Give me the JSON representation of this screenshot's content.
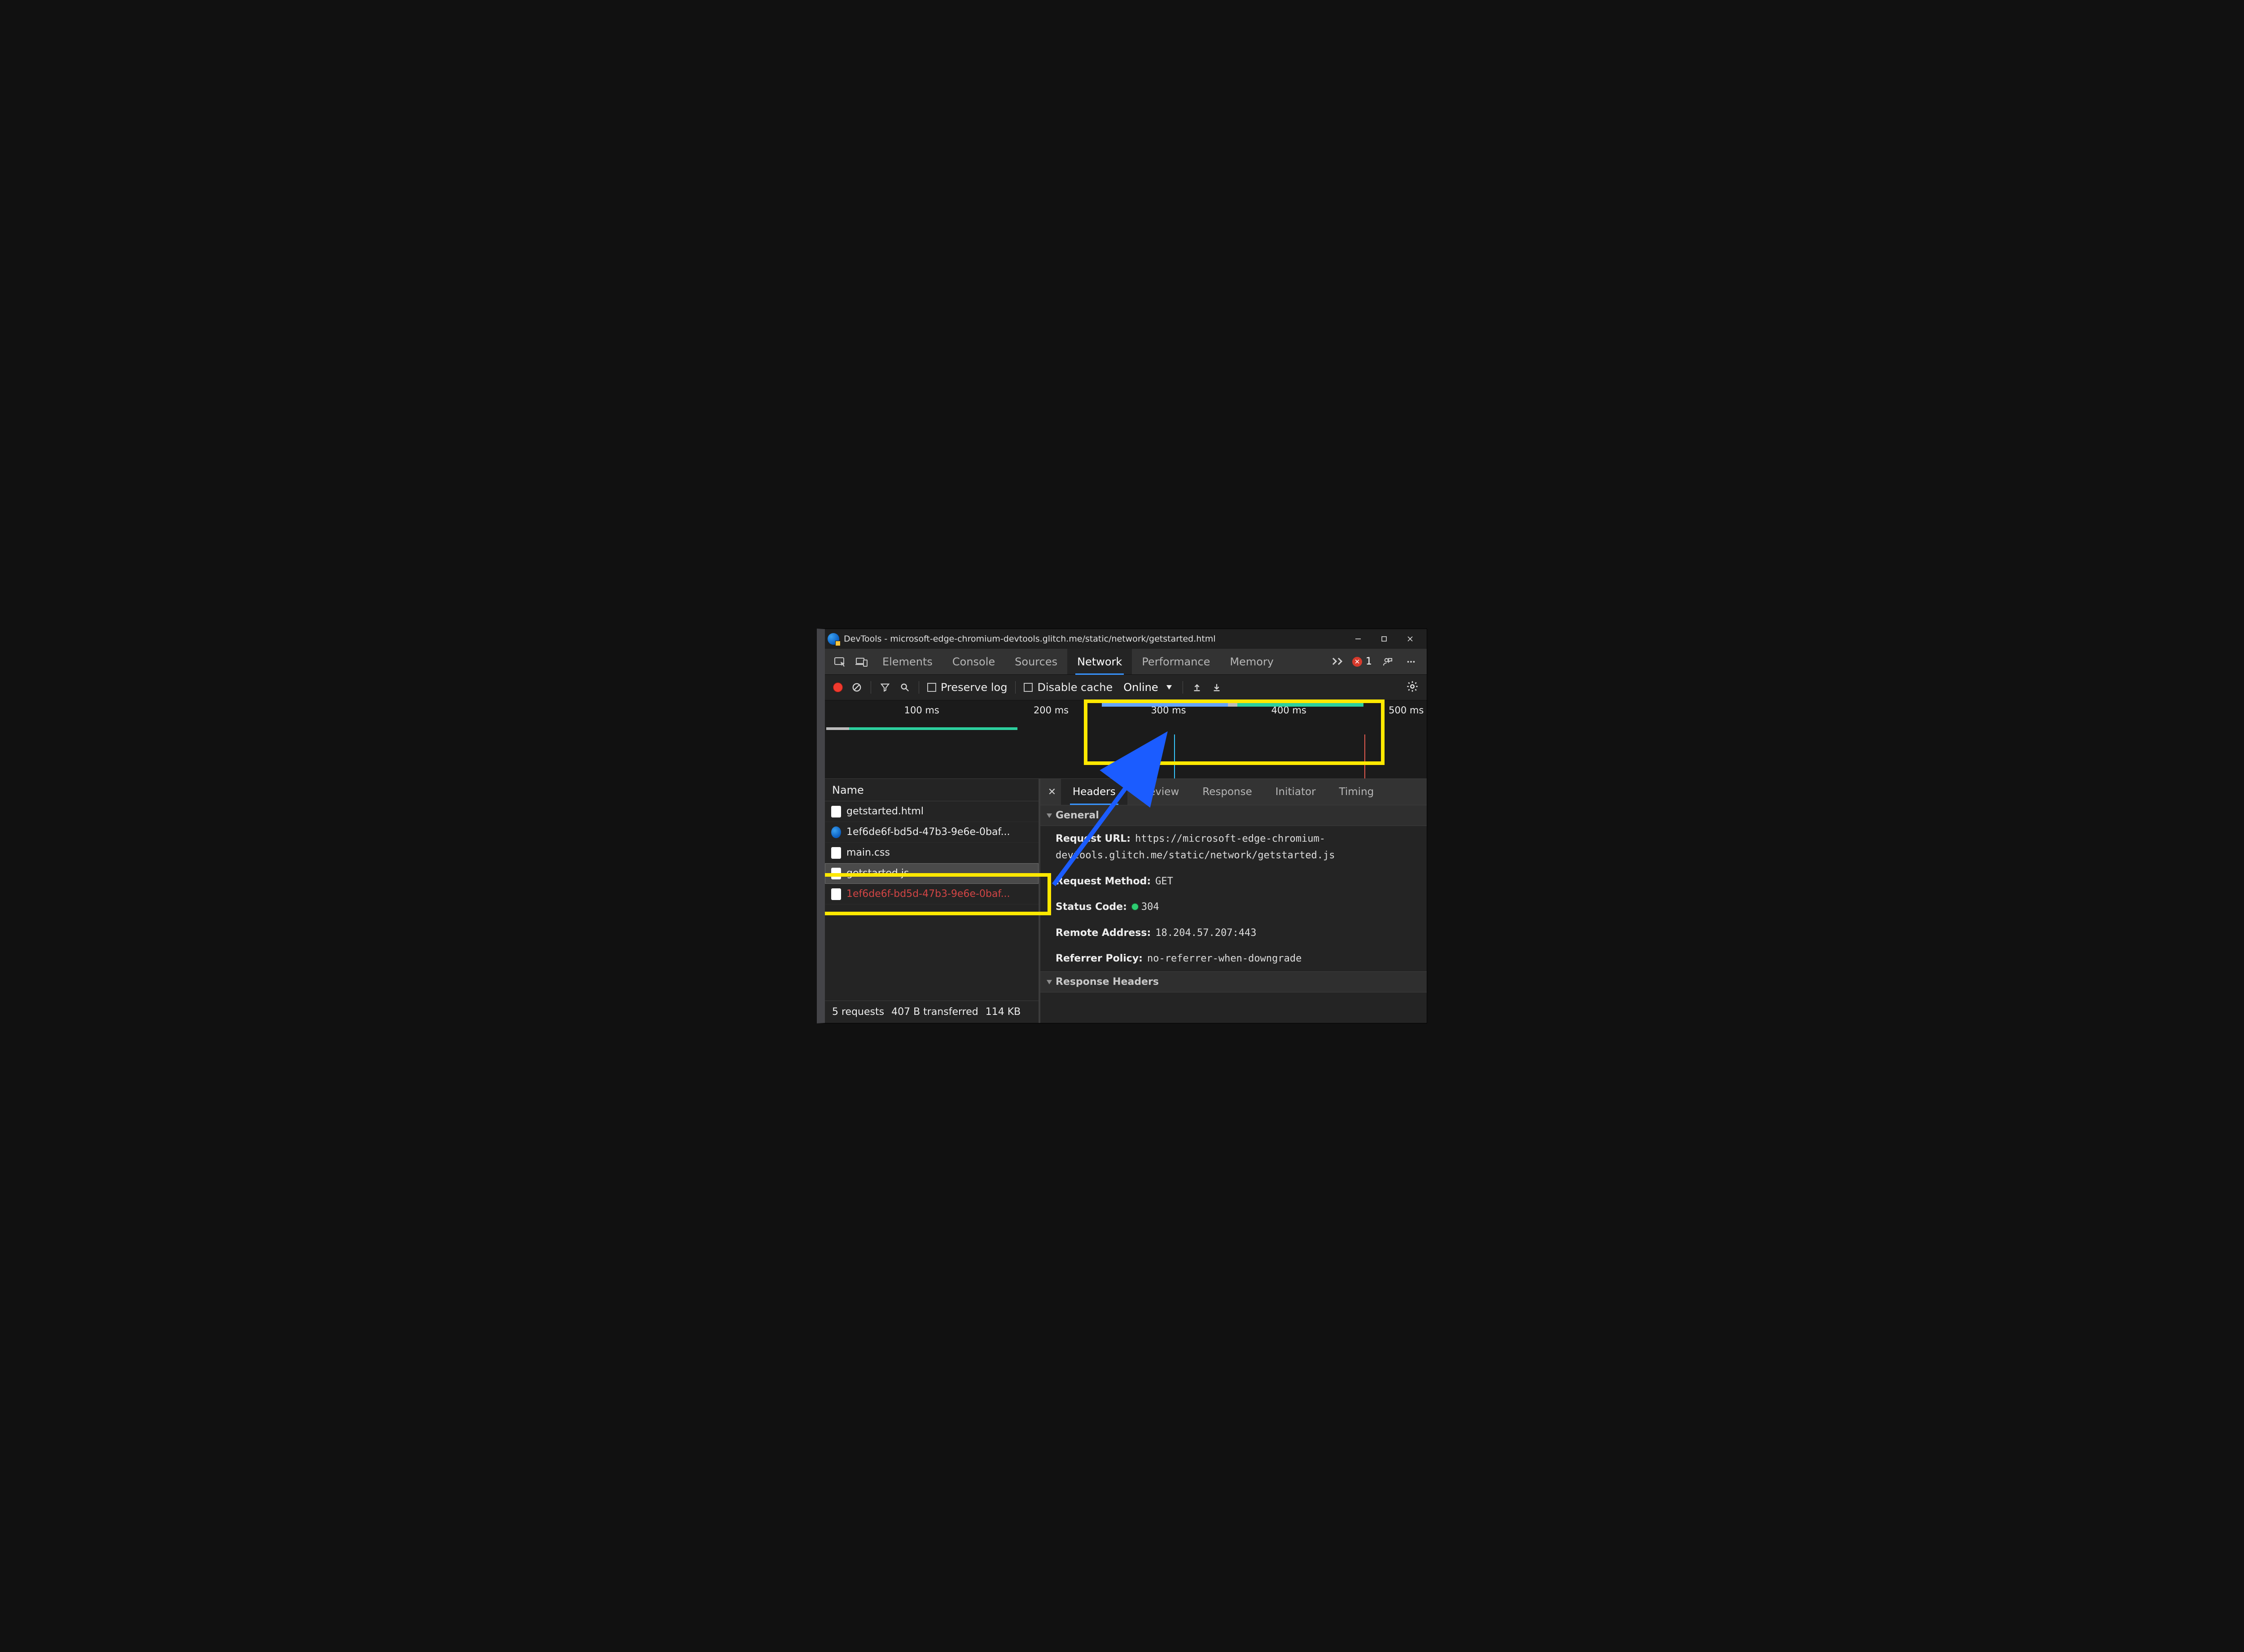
{
  "window": {
    "title": "DevTools - microsoft-edge-chromium-devtools.glitch.me/static/network/getstarted.html"
  },
  "tabs": {
    "items": [
      "Elements",
      "Console",
      "Sources",
      "Network",
      "Performance",
      "Memory"
    ],
    "active_index": 3,
    "errors_count": "1"
  },
  "toolbar": {
    "preserve_log": "Preserve log",
    "disable_cache": "Disable cache",
    "throttling": "Online"
  },
  "overview": {
    "ticks": [
      "100 ms",
      "200 ms",
      "300 ms",
      "400 ms",
      "500 ms"
    ]
  },
  "request_list": {
    "header": "Name",
    "rows": [
      {
        "name": "getstarted.html",
        "icon": "file"
      },
      {
        "name": "1ef6de6f-bd5d-47b3-9e6e-0baf...",
        "icon": "edge"
      },
      {
        "name": "main.css",
        "icon": "file"
      },
      {
        "name": "getstarted.js",
        "icon": "file",
        "selected": true
      },
      {
        "name": "1ef6de6f-bd5d-47b3-9e6e-0baf...",
        "icon": "file",
        "error": true
      }
    ],
    "footer": {
      "requests": "5 requests",
      "transferred": "407 B transferred",
      "size": "114 KB"
    }
  },
  "detail_tabs": {
    "items": [
      "Headers",
      "Preview",
      "Response",
      "Initiator",
      "Timing"
    ],
    "active_index": 0
  },
  "headers": {
    "general_label": "General",
    "request_url_label": "Request URL:",
    "request_url_value": "https://microsoft-edge-chromium-devtools.glitch.me/static/network/getstarted.js",
    "request_method_label": "Request Method:",
    "request_method_value": "GET",
    "status_code_label": "Status Code:",
    "status_code_value": "304",
    "remote_address_label": "Remote Address:",
    "remote_address_value": "18.204.57.207:443",
    "referrer_policy_label": "Referrer Policy:",
    "referrer_policy_value": "no-referrer-when-downgrade",
    "response_headers_label": "Response Headers"
  },
  "annotations": {
    "highlight_color": "#ffe800",
    "arrow_color": "#1b5cff"
  }
}
